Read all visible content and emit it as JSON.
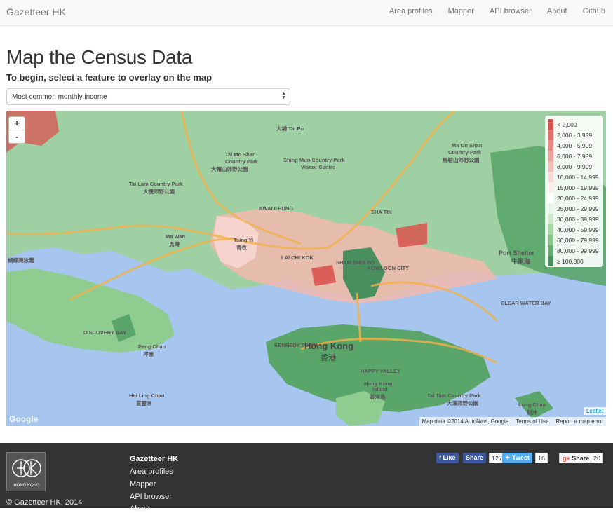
{
  "navbar": {
    "brand": "Gazetteer HK",
    "links": [
      "Area profiles",
      "Mapper",
      "API browser",
      "About",
      "Github"
    ]
  },
  "page": {
    "title": "Map the Census Data",
    "subtitle": "To begin, select a feature to overlay on the map"
  },
  "select": {
    "value": "Most common monthly income"
  },
  "map": {
    "zoom_in": "+",
    "zoom_out": "-",
    "legend": [
      {
        "label": "< 2,000",
        "color": "#d9534f"
      },
      {
        "label": "2,000 - 3,999",
        "color": "#e0706b"
      },
      {
        "label": "4,000 - 5,999",
        "color": "#e68b86"
      },
      {
        "label": "6,000 - 7,999",
        "color": "#eba6a1"
      },
      {
        "label": "8,000 - 9,999",
        "color": "#f0c0bb"
      },
      {
        "label": "10,000 - 14,999",
        "color": "#f6dad6"
      },
      {
        "label": "15,000 - 19,999",
        "color": "#fbefed"
      },
      {
        "label": "20,000 - 24,999",
        "color": "#ffffff"
      },
      {
        "label": "25,000 - 29,999",
        "color": "#eaf5ea"
      },
      {
        "label": "30,000 - 39,999",
        "color": "#cfe9cf"
      },
      {
        "label": "40,000 - 59,999",
        "color": "#abd8ab"
      },
      {
        "label": "60,000 - 79,999",
        "color": "#86c386"
      },
      {
        "label": "80,000 - 99,999",
        "color": "#63aa73"
      },
      {
        "label": "≥ 100,000",
        "color": "#4a8f60"
      }
    ],
    "places": [
      {
        "name": "大埔 Tai Po"
      },
      {
        "name": "Tai Mo Shan"
      },
      {
        "name": "Country Park"
      },
      {
        "name": "大帽山郊野公園"
      },
      {
        "name": "Shing Mun Country Park"
      },
      {
        "name": "Visitor Centre"
      },
      {
        "name": "Tai Lam Country Park"
      },
      {
        "name": "大欖郊野公園"
      },
      {
        "name": "Ma On Shan"
      },
      {
        "name": "Country Park"
      },
      {
        "name": "馬鞍山郊野公園"
      },
      {
        "name": "Ma Wan"
      },
      {
        "name": "馬灣"
      },
      {
        "name": "Tsing Yi"
      },
      {
        "name": "青衣"
      },
      {
        "name": "KWAI CHUNG"
      },
      {
        "name": "SHA TIN"
      },
      {
        "name": "SHAM SHUI PO"
      },
      {
        "name": "KOWLOON CITY"
      },
      {
        "name": "LAI CHI KOK"
      },
      {
        "name": "Port Shelter"
      },
      {
        "name": "牛尾海"
      },
      {
        "name": "蝴蝶灣泳灘"
      },
      {
        "name": "DISCOVERY BAY"
      },
      {
        "name": "Peng Chau"
      },
      {
        "name": "坪洲"
      },
      {
        "name": "Hei Ling Chau"
      },
      {
        "name": "喜靈洲"
      },
      {
        "name": "CLEAR WATER BAY"
      },
      {
        "name": "KENNEDY TOWN"
      },
      {
        "name": "HAPPY VALLEY"
      },
      {
        "name": "Hong Kong"
      },
      {
        "name": "Island"
      },
      {
        "name": "香港島"
      },
      {
        "name": "Tai Tam Country Park"
      },
      {
        "name": "大潭郊野公園"
      },
      {
        "name": "Lung Chau"
      },
      {
        "name": "龍洲"
      }
    ],
    "city_label": "Hong Kong",
    "city_label_zh": "香港",
    "attribution": [
      "Map data ©2014 AutoNavi, Google",
      "Terms of Use",
      "Report a map error"
    ],
    "leaflet": "Leaflet",
    "google_logo": "Google"
  },
  "footer": {
    "heading": "Gazetteer HK",
    "links": [
      "Area profiles",
      "Mapper",
      "API browser",
      "About"
    ],
    "copyright": "© Gazetteer HK, 2014",
    "logo_text": "HONG KONG",
    "social": {
      "like": "Like",
      "share": "Share",
      "like_count": "127",
      "tweet": "Tweet",
      "tweet_count": "16",
      "gplus": "Share",
      "gplus_count": "20"
    }
  },
  "colors": {
    "water": "#a6c6f0",
    "road": "#f2b04a",
    "navbar": "#f8f8f8",
    "footer": "#333333",
    "facebook": "#3b5998",
    "twitter": "#55acee",
    "gplus": "#dd4b39"
  }
}
